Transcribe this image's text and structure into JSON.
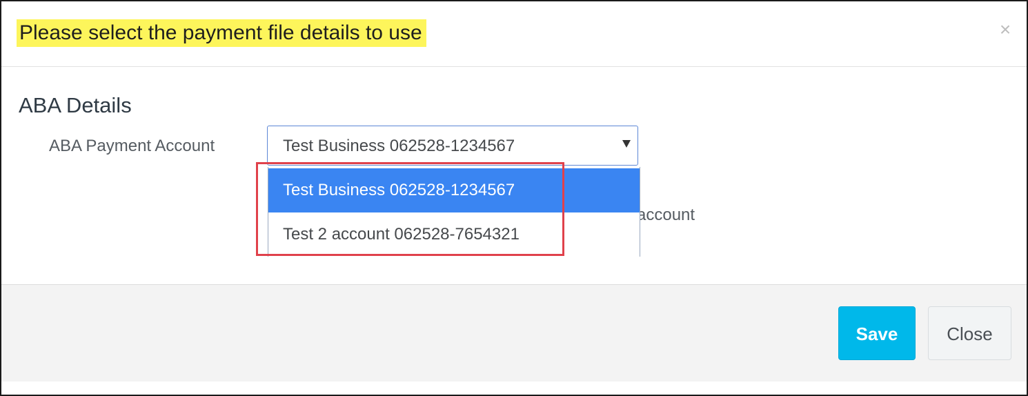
{
  "dialog": {
    "title": "Please select the payment file details to use",
    "close_symbol": "×"
  },
  "section": {
    "title": "ABA Details"
  },
  "aba_payment_account": {
    "label": "ABA Payment Account",
    "selected_value": "Test Business 062528-1234567",
    "options": [
      {
        "label": "Test Business 062528-1234567",
        "selected": true
      },
      {
        "label": "Test 2 account 062528-7654321",
        "selected": false
      }
    ]
  },
  "partially_hidden_text": "account",
  "footer": {
    "save_label": "Save",
    "close_label": "Close"
  },
  "colors": {
    "title_highlight": "#fdf55b",
    "selected_option": "#3a85f2",
    "save_button": "#00b8ea",
    "annotation_box": "#e0414b"
  }
}
